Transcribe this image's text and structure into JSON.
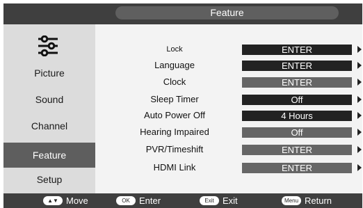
{
  "header": {
    "title": "Feature"
  },
  "sidebar": {
    "icon": "sliders-icon",
    "items": [
      {
        "label": "Picture",
        "active": false
      },
      {
        "label": "Sound",
        "active": false
      },
      {
        "label": "Channel",
        "active": false
      },
      {
        "label": "Feature",
        "active": true
      },
      {
        "label": "Setup",
        "active": false
      }
    ]
  },
  "settings": [
    {
      "label": "Lock",
      "value": "ENTER",
      "style": "dark"
    },
    {
      "label": "Language",
      "value": "ENTER",
      "style": "dark"
    },
    {
      "label": "Clock",
      "value": "ENTER",
      "style": "gray"
    },
    {
      "label": "Sleep Timer",
      "value": "Off",
      "style": "dark"
    },
    {
      "label": "Auto Power Off",
      "value": "4 Hours",
      "style": "dark"
    },
    {
      "label": "Hearing Impaired",
      "value": "Off",
      "style": "gray"
    },
    {
      "label": "PVR/Timeshift",
      "value": "ENTER",
      "style": "gray"
    },
    {
      "label": "HDMI Link",
      "value": "ENTER",
      "style": "gray"
    }
  ],
  "footer": {
    "move": {
      "key": "▲▼",
      "label": "Move"
    },
    "enter": {
      "key": "OK",
      "label": "Enter"
    },
    "exit": {
      "key": "Exit",
      "label": "Exit"
    },
    "return": {
      "key": "Menu",
      "label": "Return"
    }
  },
  "colors": {
    "dark_value": "#222222",
    "gray_value": "#666666",
    "bar": "#3f3f3f",
    "active_menu": "#5e5e5e"
  }
}
